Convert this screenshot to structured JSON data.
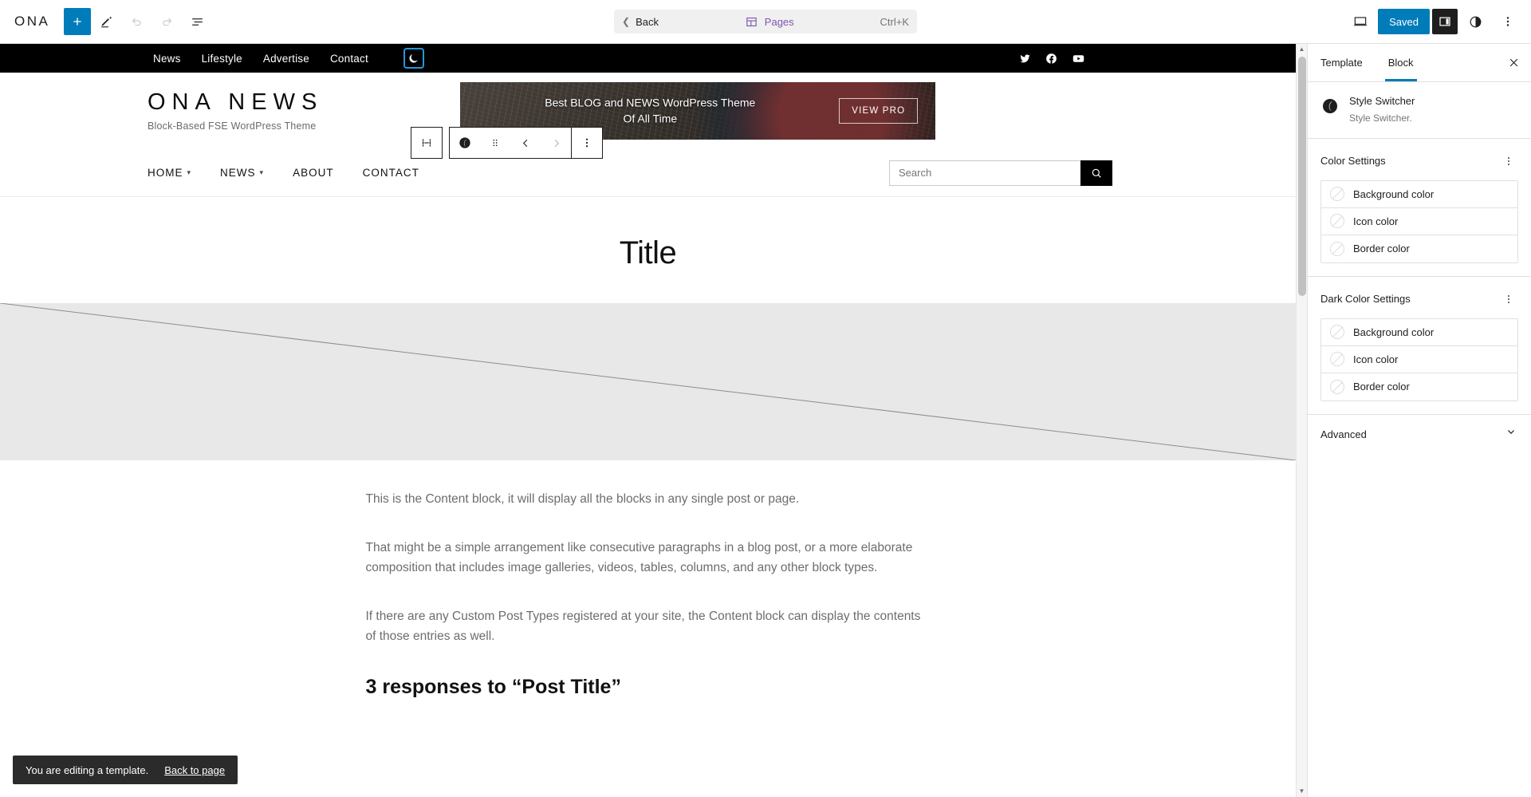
{
  "editor_bar": {
    "logo_text": "ONA",
    "add_block_label": "+",
    "tools": [
      "add-block",
      "edit-tools",
      "undo",
      "redo",
      "list-view"
    ],
    "command": {
      "back_label": "Back",
      "doc_label": "Pages",
      "shortcut": "Ctrl+K"
    },
    "right": {
      "view_label": "view-icon",
      "saved_label": "Saved",
      "settings_label": "settings-icon",
      "styles_label": "styles-icon",
      "options_label": "options-icon"
    }
  },
  "block_toolbar": {
    "parent_label": "select-parent-block",
    "block_icon_label": "style-switcher-icon",
    "drag_label": "drag-handle",
    "move_left_label": "move-left",
    "move_right_label": "move-right",
    "options_label": "more-options"
  },
  "site": {
    "topbar": {
      "nav": [
        "News",
        "Lifestyle",
        "Advertise",
        "Contact"
      ],
      "dark_toggle": "moon-icon",
      "social": [
        "twitter",
        "facebook",
        "youtube"
      ]
    },
    "logo": {
      "title": "ONA NEWS",
      "tagline": "Block-Based FSE WordPress Theme"
    },
    "promo": {
      "line1": "Best  BLOG and NEWS WordPress Theme",
      "line2": "Of All Time",
      "button": "VIEW PRO"
    },
    "mainnav": [
      {
        "label": "HOME",
        "has_submenu": true
      },
      {
        "label": "NEWS",
        "has_submenu": true
      },
      {
        "label": "ABOUT",
        "has_submenu": false
      },
      {
        "label": "CONTACT",
        "has_submenu": false
      }
    ],
    "search": {
      "placeholder": "Search",
      "value": "",
      "button": "search-icon"
    },
    "post": {
      "title": "Title",
      "paragraphs": [
        "This is the Content block, it will display all the blocks in any single post or page.",
        "That might be a simple arrangement like consecutive paragraphs in a blog post, or a more elaborate composition that includes image galleries, videos, tables, columns, and any other block types.",
        "If there are any Custom Post Types registered at your site, the Content block can display the contents of those entries as well."
      ],
      "comments_heading": "3 responses to “Post Title”"
    }
  },
  "sidebar": {
    "tabs": [
      {
        "label": "Template",
        "active": false
      },
      {
        "label": "Block",
        "active": true
      }
    ],
    "close_label": "close-icon",
    "block": {
      "name": "Style Switcher",
      "description": "Style Switcher."
    },
    "sections": [
      {
        "title": "Color Settings",
        "rows": [
          "Background color",
          "Icon color",
          "Border color"
        ]
      },
      {
        "title": "Dark Color Settings",
        "rows": [
          "Background color",
          "Icon color",
          "Border color"
        ]
      }
    ],
    "color_settings_title": "Color Settings",
    "color_rows": [
      "Background color",
      "Icon color",
      "Border color"
    ],
    "dark_color_settings_title": "Dark Color Settings",
    "dark_color_rows": [
      "Background color",
      "Icon color",
      "Border color"
    ],
    "advanced_label": "Advanced"
  },
  "snackbar": {
    "message": "You are editing a template.",
    "link": "Back to page"
  },
  "colors": {
    "accent_blue": "#007cba",
    "doc_purple": "#7f54b3",
    "dark": "#1e1e1e",
    "placeholder_gray": "#e8e8e8"
  }
}
